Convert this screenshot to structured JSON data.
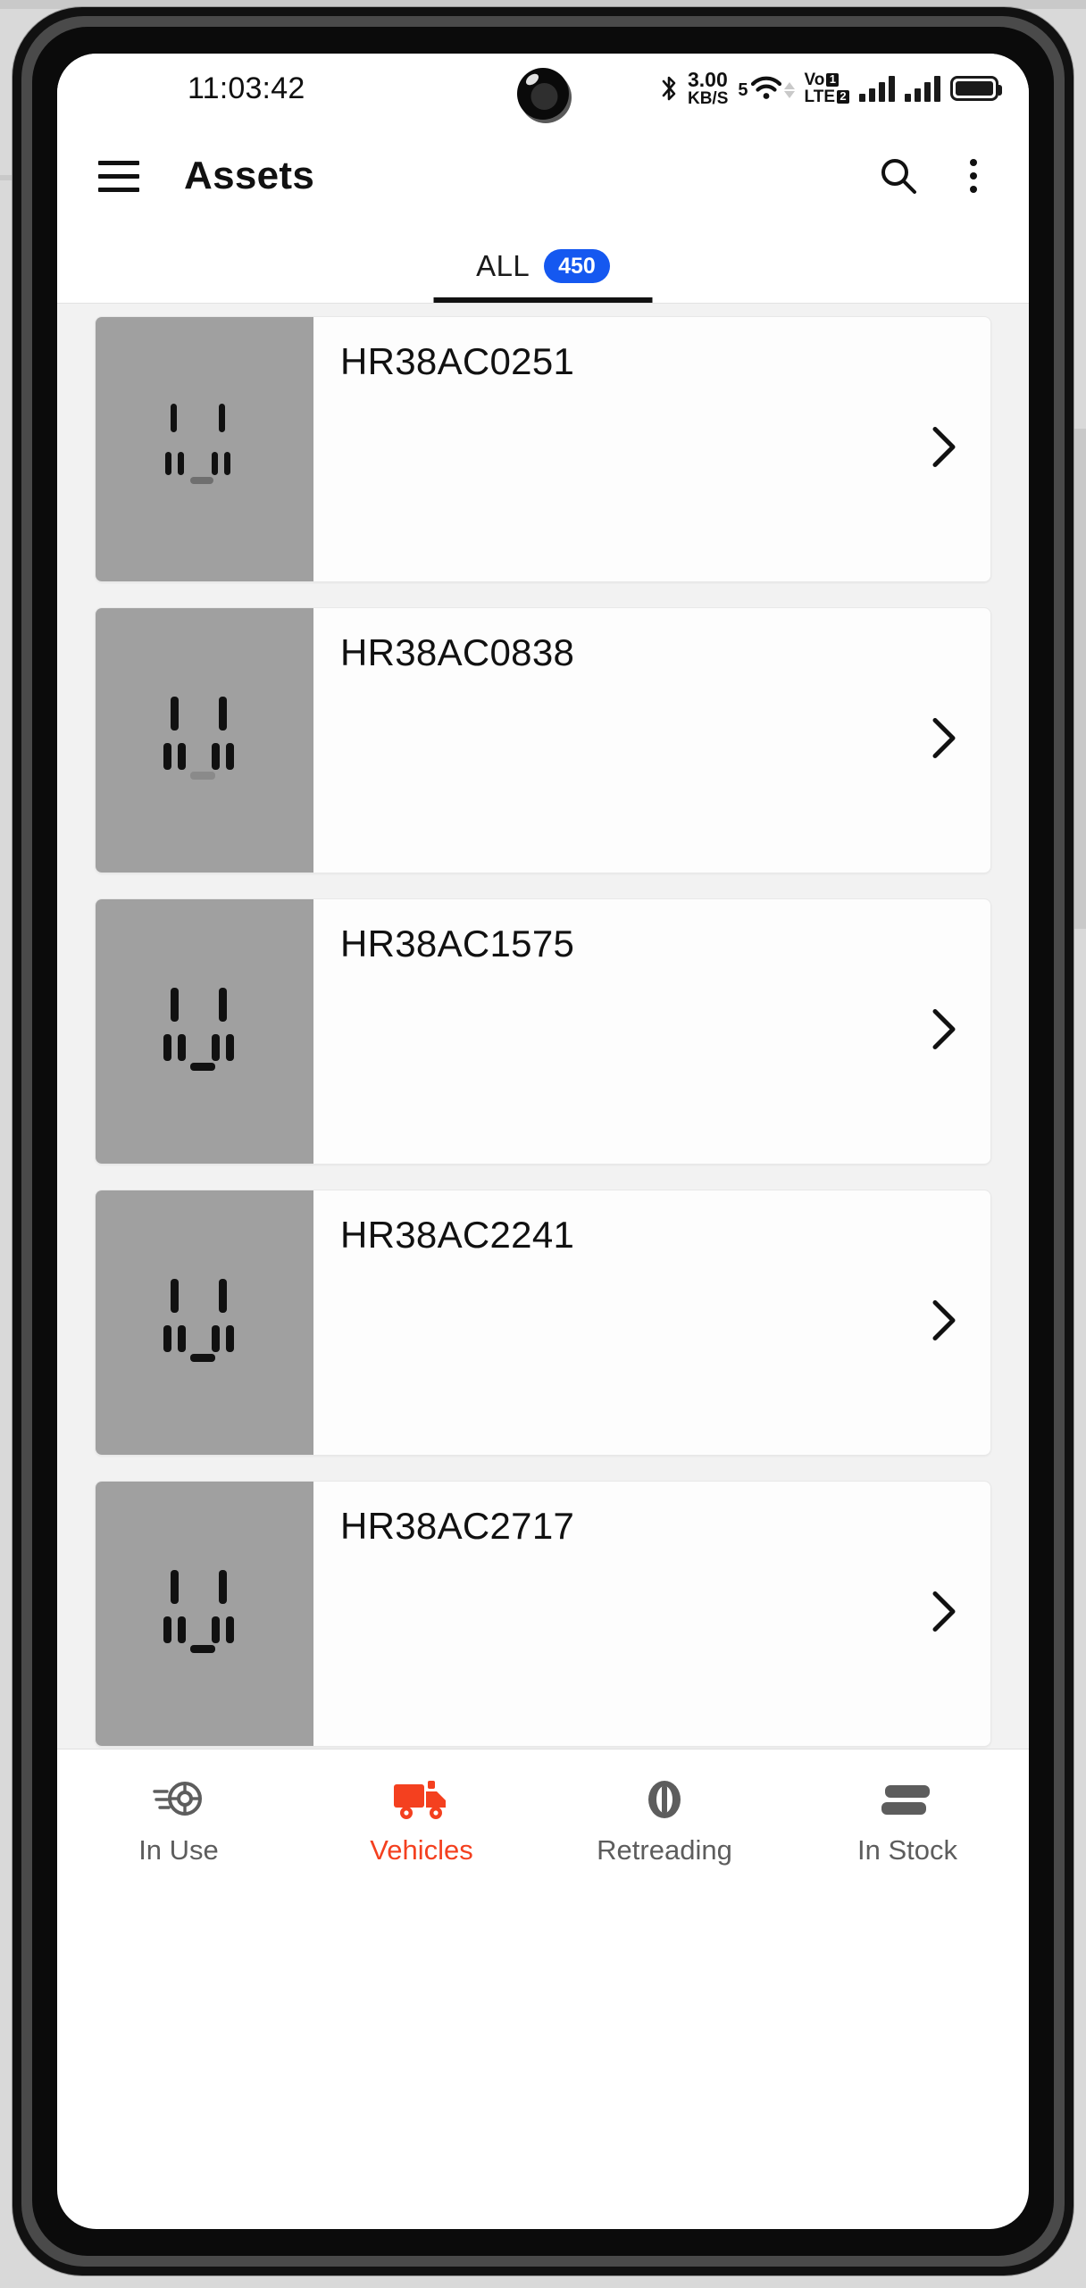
{
  "status_bar": {
    "time": "11:03:42",
    "net_speed_value": "3.00",
    "net_speed_unit": "KB/S",
    "wifi_label": "5",
    "volte_line1": "Vo",
    "volte_line2": "LTE",
    "sim1_badge": "1",
    "sim2_badge": "2",
    "icons": [
      "camera-punch-hole",
      "bluetooth-icon",
      "data-speed-icon",
      "wifi-icon",
      "volte-icon",
      "signal-icon-sim1",
      "signal-icon-sim2",
      "battery-icon"
    ]
  },
  "app_bar": {
    "menu_icon": "hamburger-menu-icon",
    "title": "Assets",
    "search_icon": "search-icon",
    "overflow_icon": "more-vertical-icon"
  },
  "tabs": [
    {
      "label": "ALL",
      "count": "450",
      "active": true
    }
  ],
  "colors": {
    "badge_blue": "#1558f0",
    "active_nav": "#f4401f",
    "thumb_gray": "#a0a0a0",
    "list_bg": "#f2f2f2"
  },
  "assets": [
    {
      "name": "HR38AC0251",
      "thumb": "broken-image-placeholder",
      "chevron": "chevron-right-icon"
    },
    {
      "name": "HR38AC0838",
      "thumb": "broken-image-placeholder",
      "chevron": "chevron-right-icon"
    },
    {
      "name": "HR38AC1575",
      "thumb": "broken-image-placeholder",
      "chevron": "chevron-right-icon"
    },
    {
      "name": "HR38AC2241",
      "thumb": "broken-image-placeholder",
      "chevron": "chevron-right-icon"
    },
    {
      "name": "HR38AC2717",
      "thumb": "broken-image-placeholder",
      "chevron": "chevron-right-icon"
    }
  ],
  "bottom_nav": [
    {
      "label": "In Use",
      "icon": "tire-in-use-icon",
      "active": false
    },
    {
      "label": "Vehicles",
      "icon": "truck-icon",
      "active": true
    },
    {
      "label": "Retreading",
      "icon": "retreading-icon",
      "active": false
    },
    {
      "label": "In Stock",
      "icon": "stacked-tires-icon",
      "active": false
    }
  ]
}
